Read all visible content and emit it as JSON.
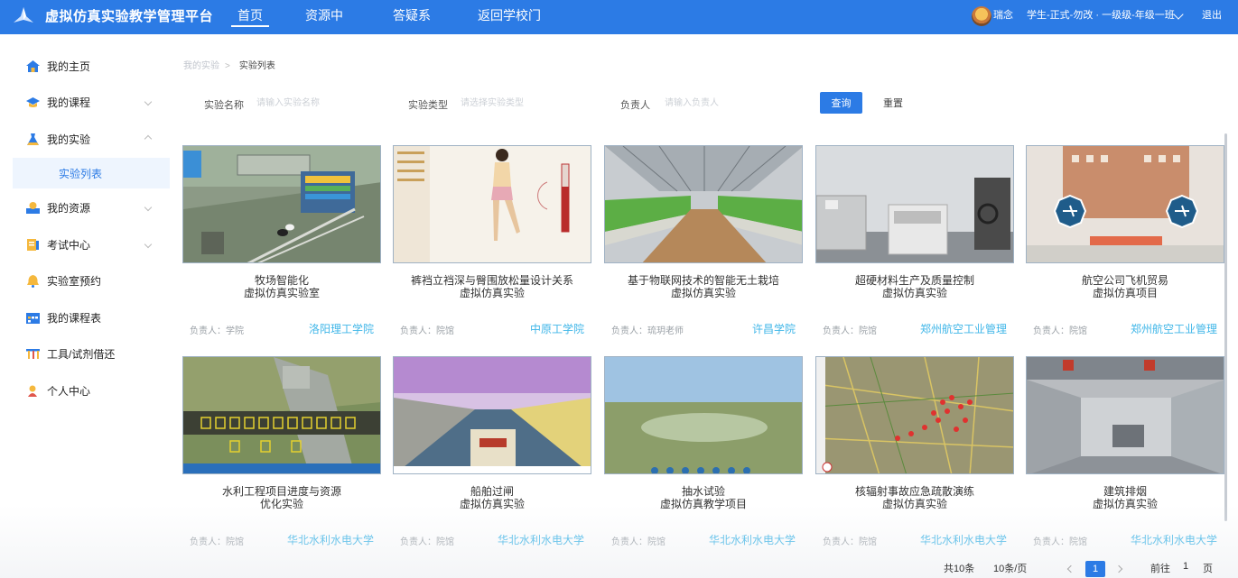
{
  "header": {
    "title": "虚拟仿真实验教学管理平台",
    "nav": [
      {
        "label": "首页",
        "active": true
      },
      {
        "label": "资源中心",
        "active": false
      },
      {
        "label": "答疑系统",
        "active": false
      },
      {
        "label": "返回学校门户",
        "active": false
      }
    ],
    "user_name": "瑞念",
    "user_role": "学生-正式-勿改 · 一级级-年级一班",
    "logout": "退出",
    "brand_color": "#2c7be5"
  },
  "sidebar": {
    "items": [
      {
        "label": "我的主页",
        "icon": "home-icon"
      },
      {
        "label": "我的课程",
        "icon": "graduation-cap-icon"
      },
      {
        "label": "我的实验",
        "icon": "flask-icon"
      },
      {
        "label": "实验列表",
        "icon": ""
      },
      {
        "label": "我的资源",
        "icon": "resource-icon"
      },
      {
        "label": "考试中心",
        "icon": "exam-icon"
      },
      {
        "label": "实验室预约",
        "icon": "bell-icon"
      },
      {
        "label": "我的课程表",
        "icon": "calendar-icon"
      },
      {
        "label": "工具/试剂借还",
        "icon": "tools-icon"
      },
      {
        "label": "个人中心",
        "icon": "person-icon"
      }
    ]
  },
  "breadcrumb": {
    "parent": "我的实验",
    "current": "实验列表"
  },
  "search": {
    "name_label": "实验名称",
    "name_placeholder": "请输入实验名称",
    "type_label": "实验类型",
    "type_placeholder": "请选择实验类型",
    "owner_label": "负责人",
    "owner_placeholder": "请输入负责人",
    "query_button": "查询",
    "reset_button": "重置"
  },
  "cards": [
    {
      "title1": "牧场智能化",
      "title2": "虚拟仿真实验室",
      "owner": "负责人：学院",
      "school": "洛阳理工学院"
    },
    {
      "title1": "裤裆立裆深与臀围放松量设计关系",
      "title2": "虚拟仿真实验",
      "owner": "负责人：院馆",
      "school": "中原工学院"
    },
    {
      "title1": "基于物联网技术的智能无土栽培",
      "title2": "虚拟仿真实验",
      "owner": "负责人：琉玥老师",
      "school": "许昌学院"
    },
    {
      "title1": "超硬材料生产及质量控制",
      "title2": "虚拟仿真实验",
      "owner": "负责人：院馆",
      "school": "郑州航空工业管理"
    },
    {
      "title1": "航空公司飞机贸易",
      "title2": "虚拟仿真项目",
      "owner": "负责人：院馆",
      "school": "郑州航空工业管理"
    },
    {
      "title1": "水利工程项目进度与资源",
      "title2": "优化实验",
      "owner": "负责人：院馆",
      "school": "华北水利水电大学"
    },
    {
      "title1": "船舶过闸",
      "title2": "虚拟仿真实验",
      "owner": "负责人：院馆",
      "school": "华北水利水电大学"
    },
    {
      "title1": "抽水试验",
      "title2": "虚拟仿真教学项目",
      "owner": "负责人：院馆",
      "school": "华北水利水电大学"
    },
    {
      "title1": "核辐射事故应急疏散演练",
      "title2": "虚拟仿真实验",
      "owner": "负责人：院馆",
      "school": "华北水利水电大学"
    },
    {
      "title1": "建筑排烟",
      "title2": "虚拟仿真实验",
      "owner": "负责人：院馆",
      "school": "华北水利水电大学"
    }
  ],
  "pagination": {
    "total": "共10条",
    "page_size": "10条/页",
    "current_page": "1",
    "goto_label": "前往",
    "goto_value": "1",
    "page_suffix": "页"
  }
}
